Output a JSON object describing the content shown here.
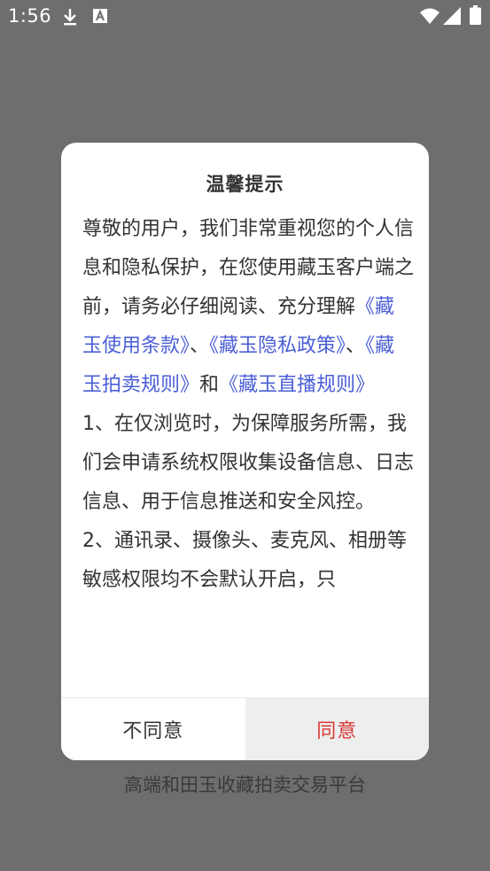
{
  "status_bar": {
    "time": "1:56",
    "icons": [
      "download-icon",
      "a-notification-icon",
      "wifi-icon",
      "signal-icon",
      "battery-icon"
    ]
  },
  "background": {
    "tagline": "高端和田玉收藏拍卖交易平台"
  },
  "dialog": {
    "title": "温馨提示",
    "intro_text": "尊敬的用户，我们非常重视您的个人信息和隐私保护，在您使用藏玉客户端之前，请务必仔细阅读、充分理解",
    "link_terms": "《藏玉使用条款》",
    "sep1": "、",
    "link_privacy": "《藏玉隐私政策》",
    "sep2": "、",
    "link_auction": "《藏玉拍卖规则》",
    "conj": "和",
    "link_live": "《藏玉直播规则》",
    "item1": "1、在仅浏览时，为保障服务所需，我们会申请系统权限收集设备信息、日志信息、用于信息推送和安全风控。",
    "item2": "2、通讯录、摄像头、麦克风、相册等敏感权限均不会默认开启，只",
    "buttons": {
      "disagree": "不同意",
      "agree": "同意"
    }
  },
  "colors": {
    "link": "#4b5fd6",
    "agree": "#d93a36",
    "overlay": "#6e6e6e"
  }
}
